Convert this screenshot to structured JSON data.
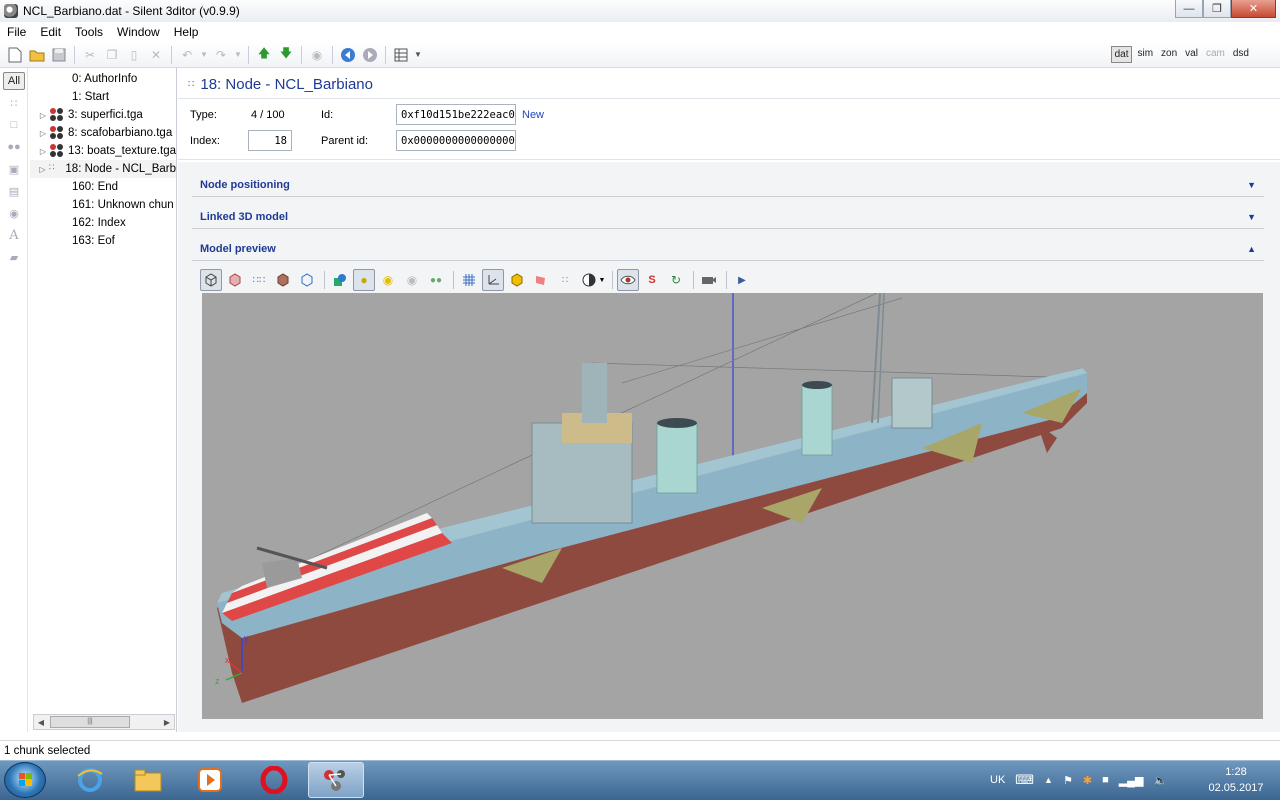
{
  "window": {
    "title": "NCL_Barbiano.dat - Silent 3ditor (v0.9.9)"
  },
  "menu": [
    "File",
    "Edit",
    "Tools",
    "Window",
    "Help"
  ],
  "modes": {
    "dat": "dat",
    "sim": "sim",
    "zon": "zon",
    "val": "val",
    "cam": "cam",
    "dsd": "dsd"
  },
  "sidebar": {
    "all_label": "All"
  },
  "tree": {
    "items": [
      {
        "label": "0: AuthorInfo"
      },
      {
        "label": "1: Start"
      },
      {
        "label": "3: superfici.tga"
      },
      {
        "label": "8: scafobarbiano.tga"
      },
      {
        "label": "13: boats_texture.tga"
      },
      {
        "label": "18: Node - NCL_Barb"
      },
      {
        "label": "160: End"
      },
      {
        "label": "161: Unknown chun"
      },
      {
        "label": "162: Index"
      },
      {
        "label": "163: Eof"
      }
    ]
  },
  "node": {
    "title": "18: Node - NCL_Barbiano",
    "type_label": "Type:",
    "type_value": "4 / 100",
    "id_label": "Id:",
    "id_value": "0xf10d151be222eac0",
    "new_label": "New",
    "index_label": "Index:",
    "index_value": "18",
    "parent_label": "Parent id:",
    "parent_value": "0x0000000000000000"
  },
  "sections": {
    "positioning": "Node positioning",
    "linked": "Linked 3D model",
    "preview": "Model preview"
  },
  "axes": {
    "x": "x",
    "y": "y",
    "z": "z"
  },
  "status": {
    "text": "1 chunk selected"
  },
  "tray": {
    "lang": "UK",
    "time": "1:28",
    "date": "02.05.2017"
  },
  "colors": {
    "accent": "#1f3a93",
    "viewport": "#a4a4a4",
    "hull": "#8f4a40",
    "deck": "#8db4c6"
  }
}
